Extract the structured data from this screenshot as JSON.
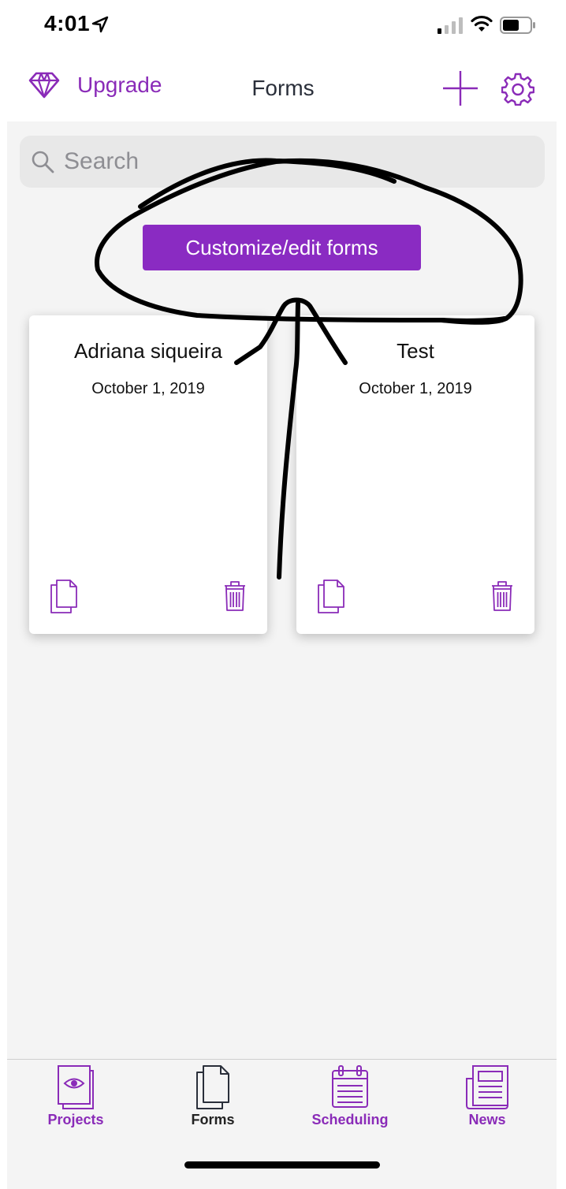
{
  "status_bar": {
    "time": "4:01"
  },
  "nav": {
    "upgrade_label": "Upgrade",
    "title": "Forms"
  },
  "search": {
    "placeholder": "Search",
    "value": ""
  },
  "customize_button": {
    "label": "Customize/edit forms"
  },
  "forms": [
    {
      "title": "Adriana siqueira",
      "date": "October 1, 2019"
    },
    {
      "title": "Test",
      "date": "October 1, 2019"
    }
  ],
  "tab_bar": {
    "tabs": [
      {
        "label": "Projects",
        "icon": "projects-icon",
        "active": false
      },
      {
        "label": "Forms",
        "icon": "forms-icon",
        "active": true
      },
      {
        "label": "Scheduling",
        "icon": "calendar-icon",
        "active": false
      },
      {
        "label": "News",
        "icon": "newspaper-icon",
        "active": false
      }
    ]
  },
  "colors": {
    "accent": "#8a2bb8",
    "button": "#8a2bc2",
    "background": "#f4f4f4",
    "active_tab": "#222222"
  }
}
